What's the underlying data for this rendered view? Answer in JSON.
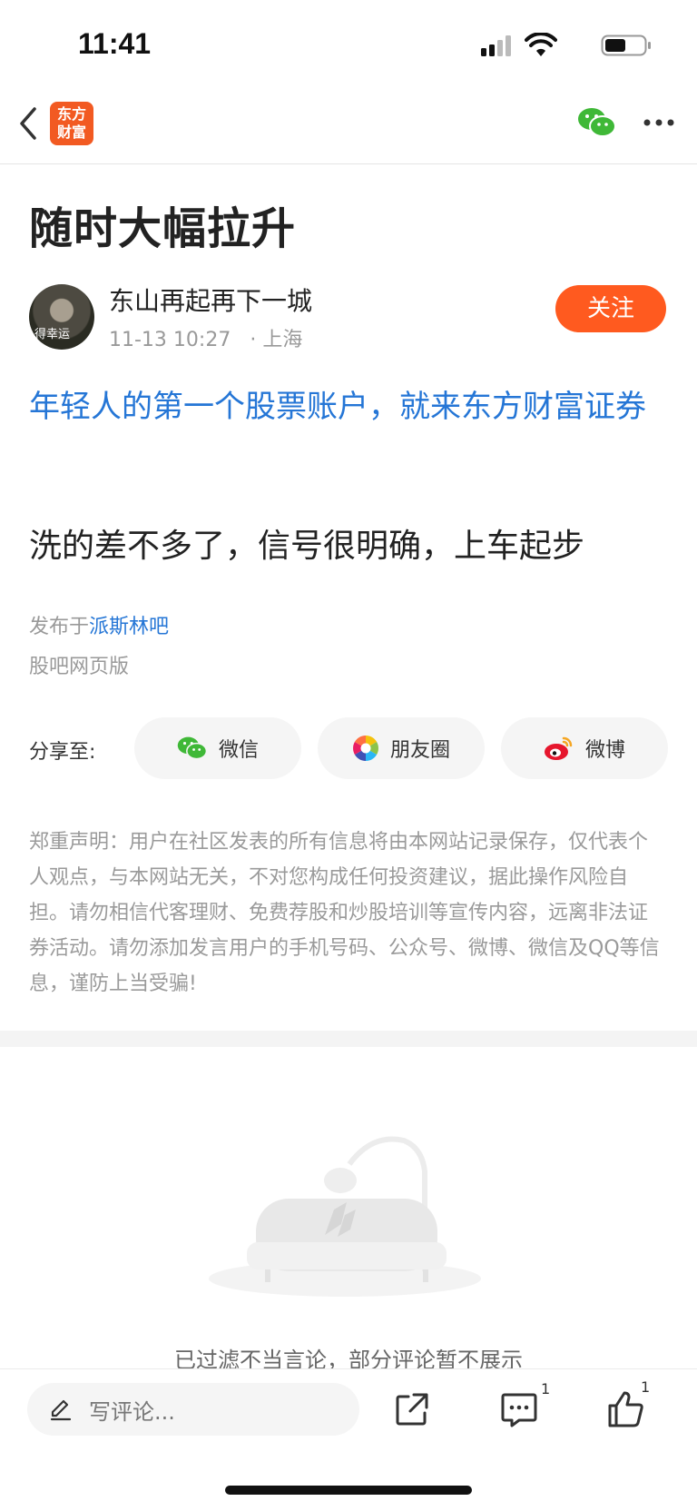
{
  "status_bar": {
    "time": "11:41"
  },
  "nav": {
    "logo_line1": "东方",
    "logo_line2": "财富"
  },
  "post": {
    "title": "随时大幅拉升",
    "author": {
      "name": "东山再起再下一城",
      "datetime": "11-13 10:27",
      "location": "· 上海",
      "follow_label": "关注",
      "avatar_text": "得幸运"
    },
    "promo_text": "年轻人的第一个股票账户，就来东方财富证券",
    "body": "洗的差不多了，信号很明确，上车起步",
    "posted_prefix": "发布于",
    "posted_bar": "派斯林吧",
    "source": "股吧网页版"
  },
  "share": {
    "label": "分享至:",
    "wechat": "微信",
    "moments": "朋友圈",
    "weibo": "微博"
  },
  "disclaimer": "郑重声明：用户在社区发表的所有信息将由本网站记录保存，仅代表个人观点，与本网站无关，不对您构成任何投资建议，据此操作风险自担。请勿相信代客理财、免费荐股和炒股培训等宣传内容，远离非法证券活动。请勿添加发言用户的手机号码、公众号、微博、微信及QQ等信息，谨防上当受骗!",
  "comments": {
    "filtered_notice": "已过滤不当言论，部分评论暂不展示"
  },
  "bottom_bar": {
    "comment_placeholder": "写评论...",
    "comment_count": "1",
    "like_count": "1"
  },
  "colors": {
    "brand": "#f25a22",
    "follow": "#ff5a1f",
    "link": "#2576d6",
    "wechat": "#3fb837"
  }
}
